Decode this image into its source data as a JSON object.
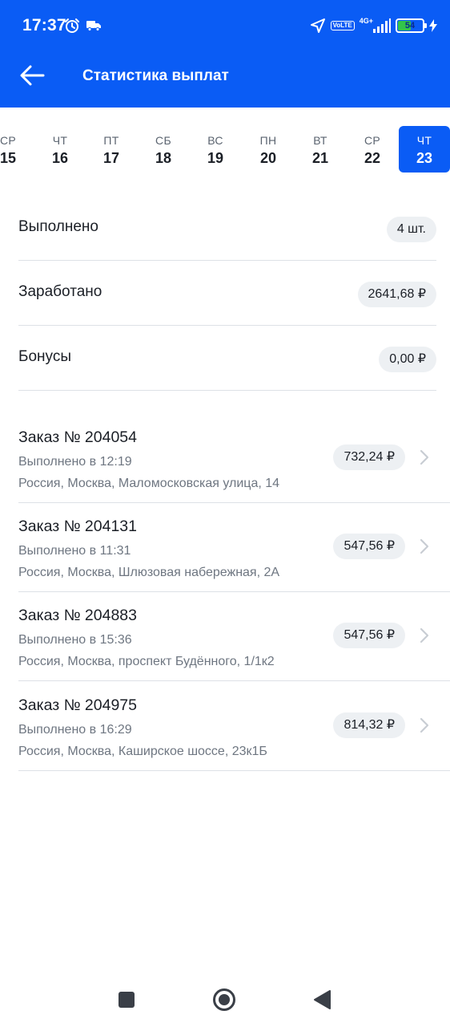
{
  "status_bar": {
    "time": "17:37",
    "left_icons": [
      "alarm-icon",
      "truck-icon"
    ],
    "right_icons": [
      "location-arrow-icon",
      "volte-icon",
      "signal-icon",
      "battery-icon",
      "charging-icon"
    ],
    "volte": "Vo\nLTE",
    "network": "4G+",
    "battery_percent": 54,
    "battery_label": "54"
  },
  "app_bar": {
    "title": "Статистика выплат",
    "back_icon": "arrow-left-icon"
  },
  "colors": {
    "primary": "#0a5cf5",
    "pill_bg": "#edf0f3",
    "divider": "#dde1e6",
    "battery_fill": "#33c44a"
  },
  "dates": [
    {
      "weekday": "СР",
      "day": "15",
      "active": false
    },
    {
      "weekday": "ЧТ",
      "day": "16",
      "active": false
    },
    {
      "weekday": "ПТ",
      "day": "17",
      "active": false
    },
    {
      "weekday": "СБ",
      "day": "18",
      "active": false
    },
    {
      "weekday": "ВС",
      "day": "19",
      "active": false
    },
    {
      "weekday": "ПН",
      "day": "20",
      "active": false
    },
    {
      "weekday": "ВТ",
      "day": "21",
      "active": false
    },
    {
      "weekday": "СР",
      "day": "22",
      "active": false
    },
    {
      "weekday": "ЧТ",
      "day": "23",
      "active": true
    }
  ],
  "summary": {
    "completed": {
      "label": "Выполнено",
      "value": "4 шт."
    },
    "earned": {
      "label": "Заработано",
      "value": "2641,68 ₽"
    },
    "bonuses": {
      "label": "Бонусы",
      "value": "0,00 ₽"
    }
  },
  "orders": [
    {
      "title": "Заказ № 204054",
      "time": "Выполнено в 12:19",
      "address": "Россия, Москва, Маломосковская улица, 14",
      "amount": "732,24 ₽"
    },
    {
      "title": "Заказ № 204131",
      "time": "Выполнено в 11:31",
      "address": "Россия, Москва, Шлюзовая набережная, 2А",
      "amount": "547,56 ₽"
    },
    {
      "title": "Заказ № 204883",
      "time": "Выполнено в 15:36",
      "address": "Россия, Москва, проспект Будённого, 1/1к2",
      "amount": "547,56 ₽"
    },
    {
      "title": "Заказ № 204975",
      "time": "Выполнено в 16:29",
      "address": "Россия, Москва, Каширское шоссе, 23к1Б",
      "amount": "814,32 ₽"
    }
  ],
  "nav_bar": {
    "buttons": [
      "recents-square-icon",
      "home-circle-icon",
      "back-triangle-icon"
    ]
  }
}
